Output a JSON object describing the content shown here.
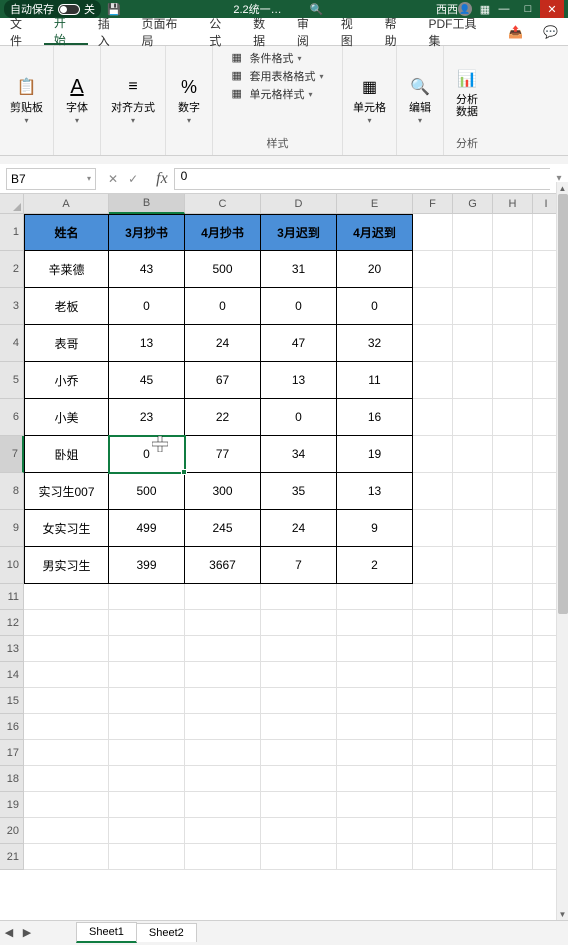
{
  "titlebar": {
    "auto_save_label": "自动保存",
    "auto_save_state": "关",
    "filename": "2.2统一…",
    "user": "西西",
    "search_icon": "search"
  },
  "tabs": {
    "file": "文件",
    "home": "开始",
    "insert": "插入",
    "layout": "页面布局",
    "formulas": "公式",
    "data": "数据",
    "review": "审阅",
    "view": "视图",
    "help": "帮助",
    "pdf": "PDF工具集"
  },
  "ribbon": {
    "clipboard": {
      "label": "剪贴板"
    },
    "font": {
      "label": "字体"
    },
    "align": {
      "label": "对齐方式"
    },
    "number": {
      "label": "数字",
      "percent": "%"
    },
    "styles": {
      "label": "样式",
      "conditional": "条件格式",
      "table_format": "套用表格格式",
      "cell_style": "单元格样式"
    },
    "cells": {
      "label": "单元格"
    },
    "editing": {
      "label": "编辑"
    },
    "analysis": {
      "label": "分析",
      "button": "分析\n数据"
    }
  },
  "namebox": "B7",
  "fx_label": "fx",
  "formula_value": "0",
  "columns": [
    "A",
    "B",
    "C",
    "D",
    "E",
    "F",
    "G",
    "H",
    "I"
  ],
  "rows_visible": [
    1,
    2,
    3,
    4,
    5,
    6,
    7,
    8,
    9,
    10,
    11,
    12,
    13,
    14,
    15,
    16,
    17,
    18,
    19,
    20,
    21
  ],
  "headers": [
    "姓名",
    "3月抄书",
    "4月抄书",
    "3月迟到",
    "4月迟到"
  ],
  "chart_data": {
    "type": "table",
    "columns": [
      "姓名",
      "3月抄书",
      "4月抄书",
      "3月迟到",
      "4月迟到"
    ],
    "rows": [
      {
        "姓名": "辛莱德",
        "3月抄书": 43,
        "4月抄书": 500,
        "3月迟到": 31,
        "4月迟到": 20
      },
      {
        "姓名": "老板",
        "3月抄书": 0,
        "4月抄书": 0,
        "3月迟到": 0,
        "4月迟到": 0
      },
      {
        "姓名": "表哥",
        "3月抄书": 13,
        "4月抄书": 24,
        "3月迟到": 47,
        "4月迟到": 32
      },
      {
        "姓名": "小乔",
        "3月抄书": 45,
        "4月抄书": 67,
        "3月迟到": 13,
        "4月迟到": 11
      },
      {
        "姓名": "小美",
        "3月抄书": 23,
        "4月抄书": 22,
        "3月迟到": 0,
        "4月迟到": 16
      },
      {
        "姓名": "卧姐",
        "3月抄书": 0,
        "4月抄书": 77,
        "3月迟到": 34,
        "4月迟到": 19
      },
      {
        "姓名": "实习生007",
        "3月抄书": 500,
        "4月抄书": 300,
        "3月迟到": 35,
        "4月迟到": 13
      },
      {
        "姓名": "女实习生",
        "3月抄书": 499,
        "4月抄书": 245,
        "3月迟到": 24,
        "4月迟到": 9
      },
      {
        "姓名": "男实习生",
        "3月抄书": 399,
        "4月抄书": 3667,
        "3月迟到": 7,
        "4月迟到": 2
      }
    ]
  },
  "selected_cell": "B7",
  "selected_value": "0",
  "sheets": [
    "Sheet1",
    "Sheet2"
  ]
}
